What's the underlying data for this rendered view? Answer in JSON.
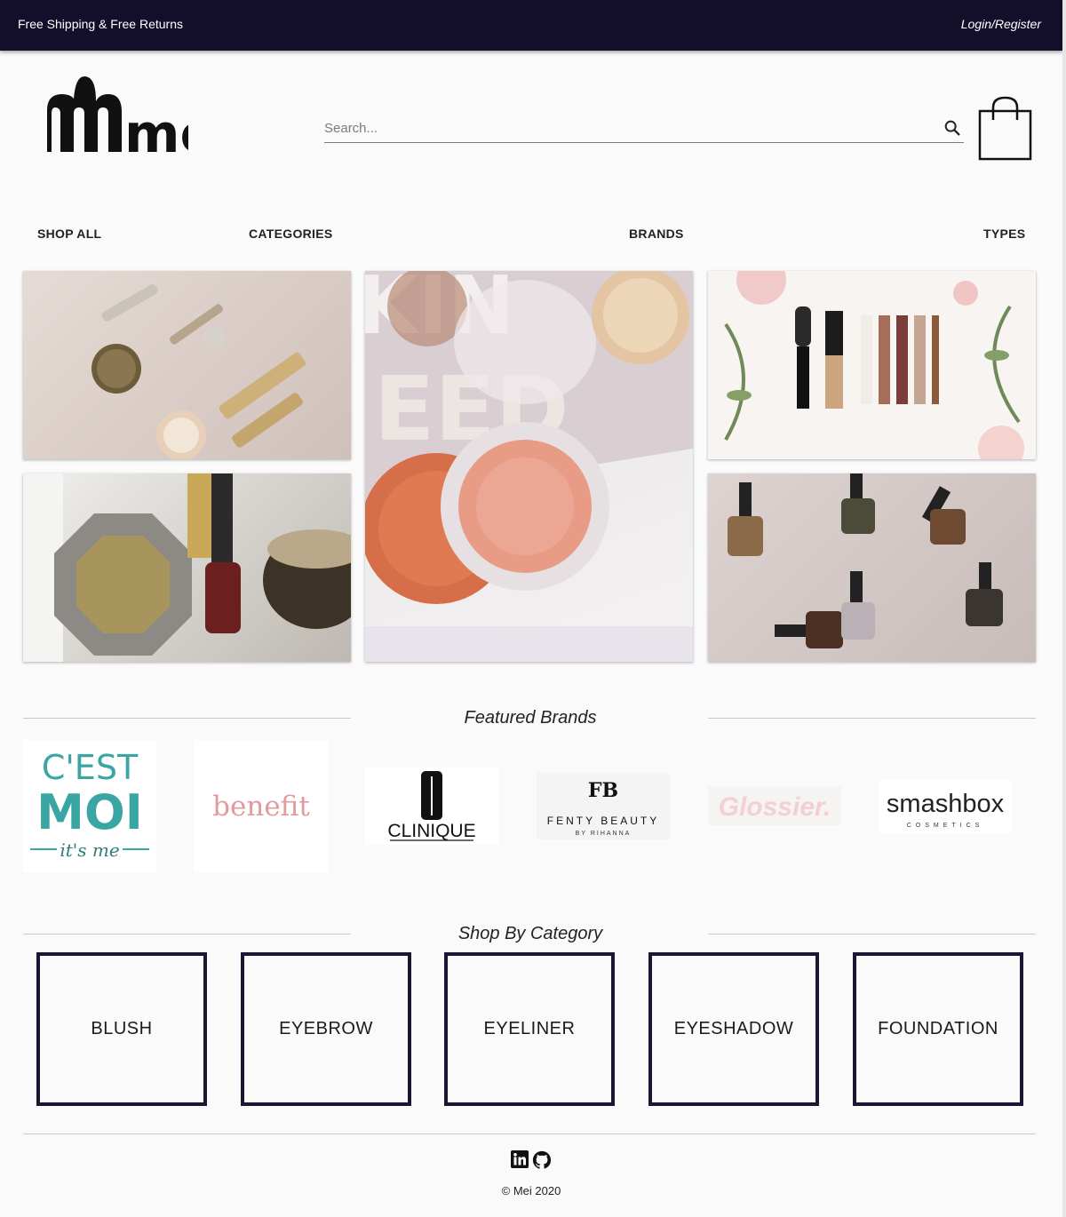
{
  "topbar": {
    "shipping": "Free Shipping & Free Returns",
    "login": "Login/Register"
  },
  "header": {
    "logo_text": "mei",
    "search_placeholder": "Search..."
  },
  "nav": [
    "SHOP ALL",
    "CATEGORIES",
    "BRANDS",
    "TYPES"
  ],
  "featured_brands": {
    "title": "Featured Brands",
    "brands": [
      {
        "name": "C'EST MOI",
        "line1": "C'EST",
        "line2": "MOI",
        "line3": "it's me"
      },
      {
        "name": "benefit"
      },
      {
        "name": "CLINIQUE"
      },
      {
        "name": "FENTY BEAUTY",
        "sub": "BY RIHANNA"
      },
      {
        "name": "Glossier."
      },
      {
        "name": "smashbox",
        "sub": "COSMETICS"
      }
    ]
  },
  "shop_by_category": {
    "title": "Shop By Category",
    "categories": [
      "BLUSH",
      "EYEBROW",
      "EYELINER",
      "EYESHADOW",
      "FOUNDATION"
    ]
  },
  "footer": {
    "copyright": "© Mei 2020",
    "icons": [
      "linkedin-icon",
      "github-icon"
    ]
  },
  "colors": {
    "topbar": "#130f2a",
    "category_border": "#1b1732",
    "moi_teal": "#3aa6a4",
    "benefit_pink": "#e29a9d"
  }
}
